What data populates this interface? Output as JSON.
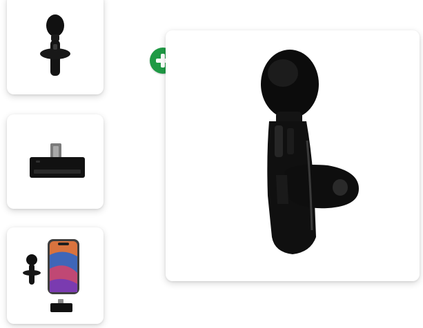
{
  "thumbnails": [
    {
      "icon": "microphone-icon"
    },
    {
      "icon": "usb-c-receiver-icon"
    },
    {
      "icon": "phone-with-microphone-icon"
    }
  ],
  "add_icon": "plus-icon",
  "main_image": {
    "icon": "clip-microphone-icon"
  },
  "colors": {
    "accent_green": "#1f9a45",
    "product_black": "#111111"
  }
}
